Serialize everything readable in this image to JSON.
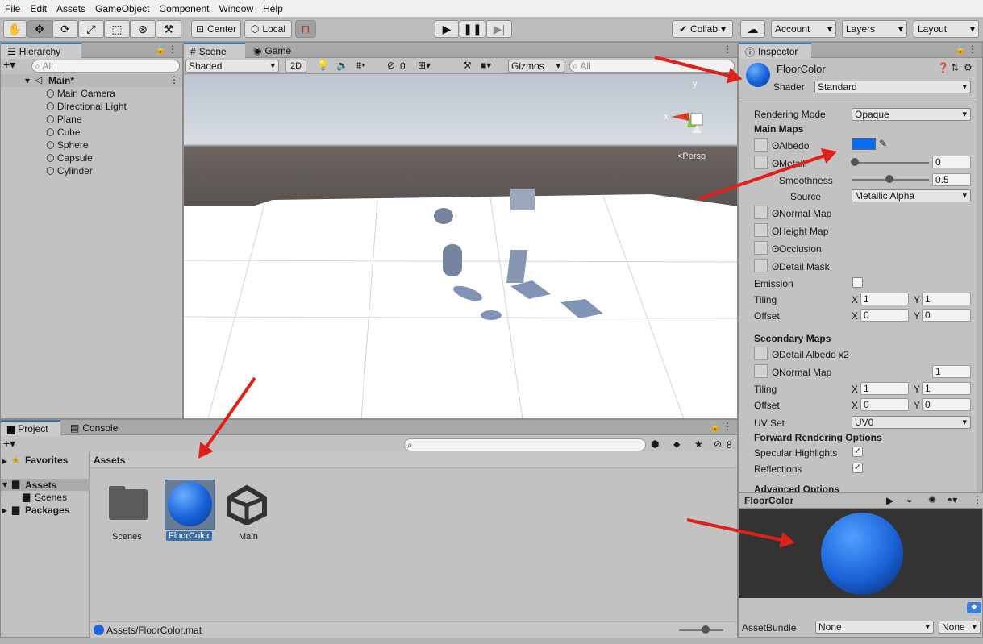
{
  "menu": [
    "File",
    "Edit",
    "Assets",
    "GameObject",
    "Component",
    "Window",
    "Help"
  ],
  "toolbar": {
    "center": "Center",
    "local": "Local",
    "collab": "Collab",
    "account": "Account",
    "layers": "Layers",
    "layout": "Layout"
  },
  "hierarchy": {
    "tab": "Hierarchy",
    "search": "All",
    "scene": "Main*",
    "items": [
      "Main Camera",
      "Directional Light",
      "Plane",
      "Cube",
      "Sphere",
      "Capsule",
      "Cylinder"
    ]
  },
  "scene": {
    "tab_scene": "Scene",
    "tab_game": "Game",
    "shading": "Shaded",
    "mode2d": "2D",
    "hidden_count": "0",
    "gizmos": "Gizmos",
    "search": "All",
    "persp": "<Persp",
    "axis_y": "y",
    "axis_x": "x"
  },
  "project": {
    "tab_project": "Project",
    "tab_console": "Console",
    "favorites": "Favorites",
    "assets": "Assets",
    "scenes": "Scenes",
    "packages": "Packages",
    "header": "Assets",
    "badge": "8",
    "items": [
      "Scenes",
      "FloorColor",
      "Main"
    ],
    "path": "Assets/FloorColor.mat"
  },
  "inspector": {
    "tab": "Inspector",
    "name": "FloorColor",
    "shader_label": "Shader",
    "shader": "Standard",
    "rendering_mode_label": "Rendering Mode",
    "rendering_mode": "Opaque",
    "main_maps": "Main Maps",
    "albedo": "Albedo",
    "albedo_color": "#0a6cf0",
    "metallic": "Metalli",
    "metallic_value": "0",
    "smoothness": "Smoothness",
    "smoothness_value": "0.5",
    "source_label": "Source",
    "source": "Metallic Alpha",
    "normal_map": "Normal Map",
    "height_map": "Height Map",
    "occlusion": "Occlusion",
    "detail_mask": "Detail Mask",
    "emission": "Emission",
    "tiling": "Tiling",
    "offset": "Offset",
    "x": "X",
    "y": "Y",
    "tiling_x": "1",
    "tiling_y": "1",
    "offset_x": "0",
    "offset_y": "0",
    "secondary_maps": "Secondary Maps",
    "detail_albedo": "Detail Albedo x2",
    "normal_map2": "Normal Map",
    "normal_value": "1",
    "tiling2_x": "1",
    "tiling2_y": "1",
    "offset2_x": "0",
    "offset2_y": "0",
    "uv_set_label": "UV Set",
    "uv_set": "UV0",
    "forward": "Forward Rendering Options",
    "specular": "Specular Highlights",
    "reflections": "Reflections",
    "advanced": "Advanced Options"
  },
  "preview": {
    "title": "FloorColor",
    "assetbundle": "AssetBundle",
    "none1": "None",
    "none2": "None"
  }
}
